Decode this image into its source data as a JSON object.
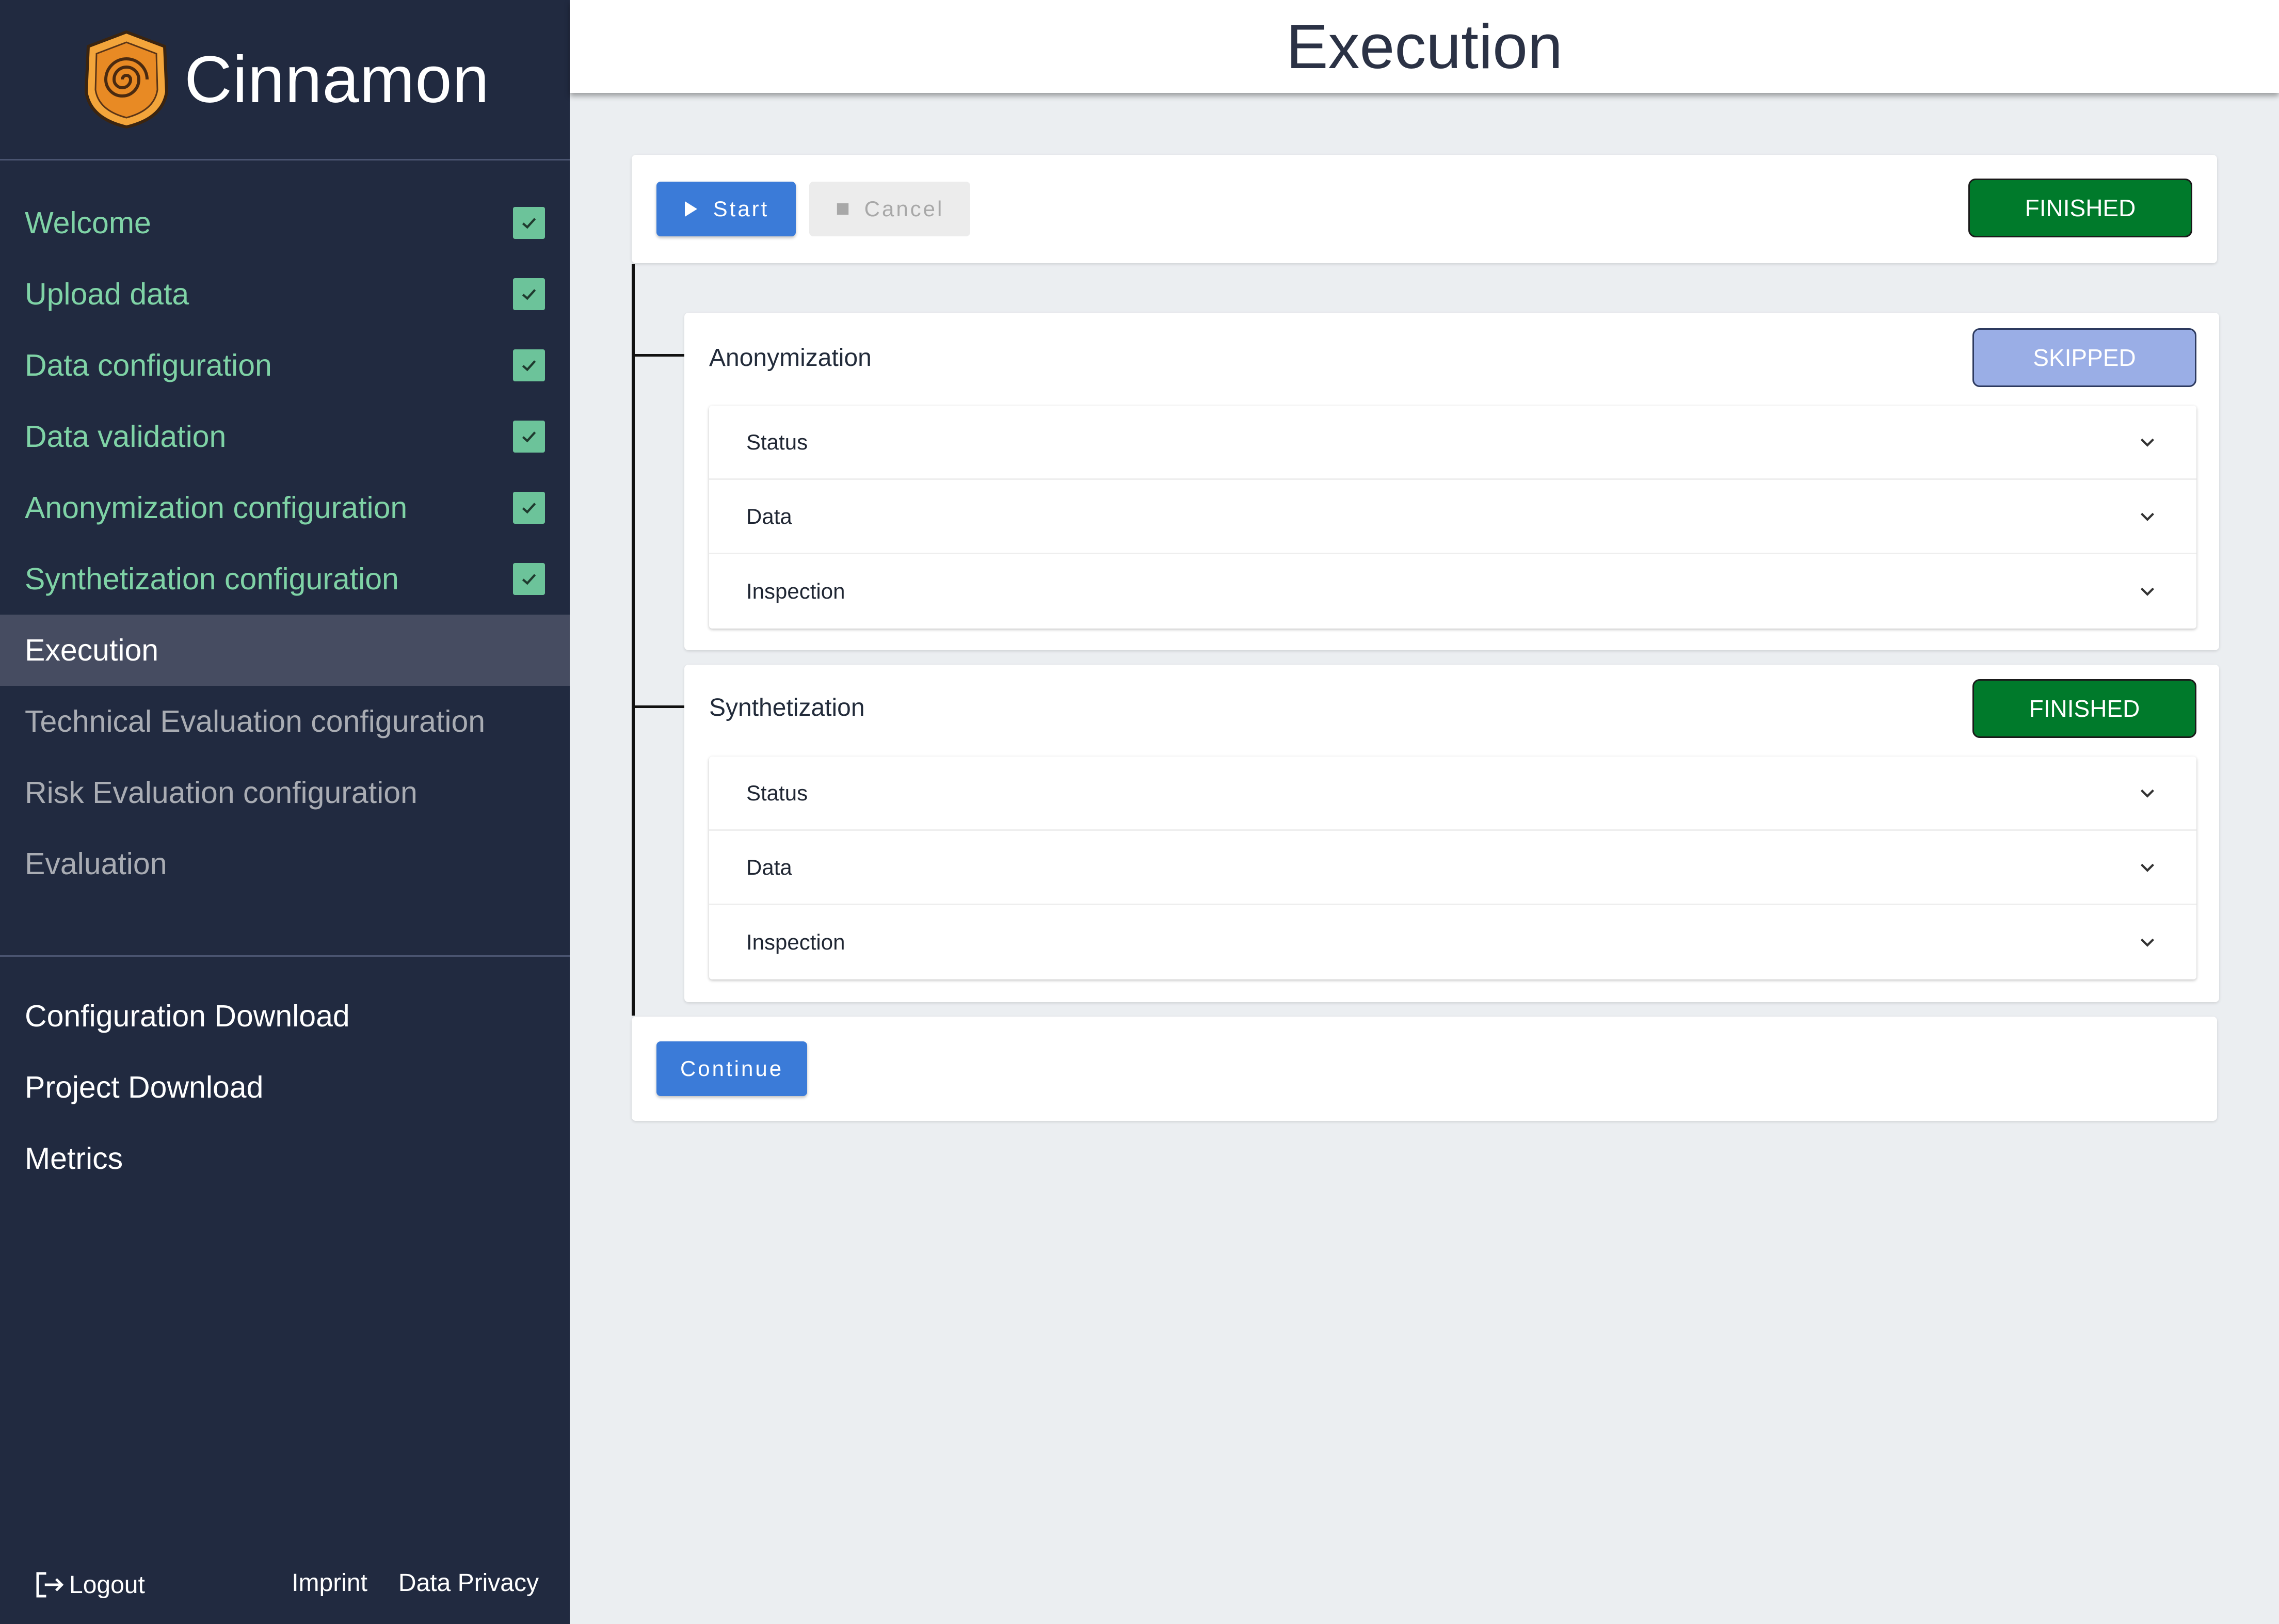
{
  "brand": {
    "name": "Cinnamon",
    "logo_icon": "cinnamon-roll-logo"
  },
  "header": {
    "title": "Execution"
  },
  "sidebar": {
    "steps": [
      {
        "label": "Welcome",
        "state": "done"
      },
      {
        "label": "Upload data",
        "state": "done"
      },
      {
        "label": "Data configuration",
        "state": "done"
      },
      {
        "label": "Data validation",
        "state": "done"
      },
      {
        "label": "Anonymization configuration",
        "state": "done"
      },
      {
        "label": "Synthetization configuration",
        "state": "done"
      },
      {
        "label": "Execution",
        "state": "active"
      },
      {
        "label": "Technical Evaluation configuration",
        "state": "todo"
      },
      {
        "label": "Risk Evaluation configuration",
        "state": "todo"
      },
      {
        "label": "Evaluation",
        "state": "todo"
      }
    ],
    "links": [
      {
        "label": "Configuration Download"
      },
      {
        "label": "Project Download"
      },
      {
        "label": "Metrics"
      }
    ],
    "footer": {
      "logout": "Logout",
      "imprint": "Imprint",
      "privacy": "Data Privacy"
    }
  },
  "toolbar": {
    "start_label": "Start",
    "cancel_label": "Cancel",
    "status": "FINISHED"
  },
  "steps": [
    {
      "title": "Anonymization",
      "status": "SKIPPED",
      "rows": [
        "Status",
        "Data",
        "Inspection"
      ]
    },
    {
      "title": "Synthetization",
      "status": "FINISHED",
      "rows": [
        "Status",
        "Data",
        "Inspection"
      ]
    }
  ],
  "continue_label": "Continue",
  "colors": {
    "sidebar_bg": "#212a40",
    "done_text": "#7fd3a6",
    "primary": "#3b7bd8",
    "finished": "#007a2b",
    "skipped": "#9aaee6"
  }
}
